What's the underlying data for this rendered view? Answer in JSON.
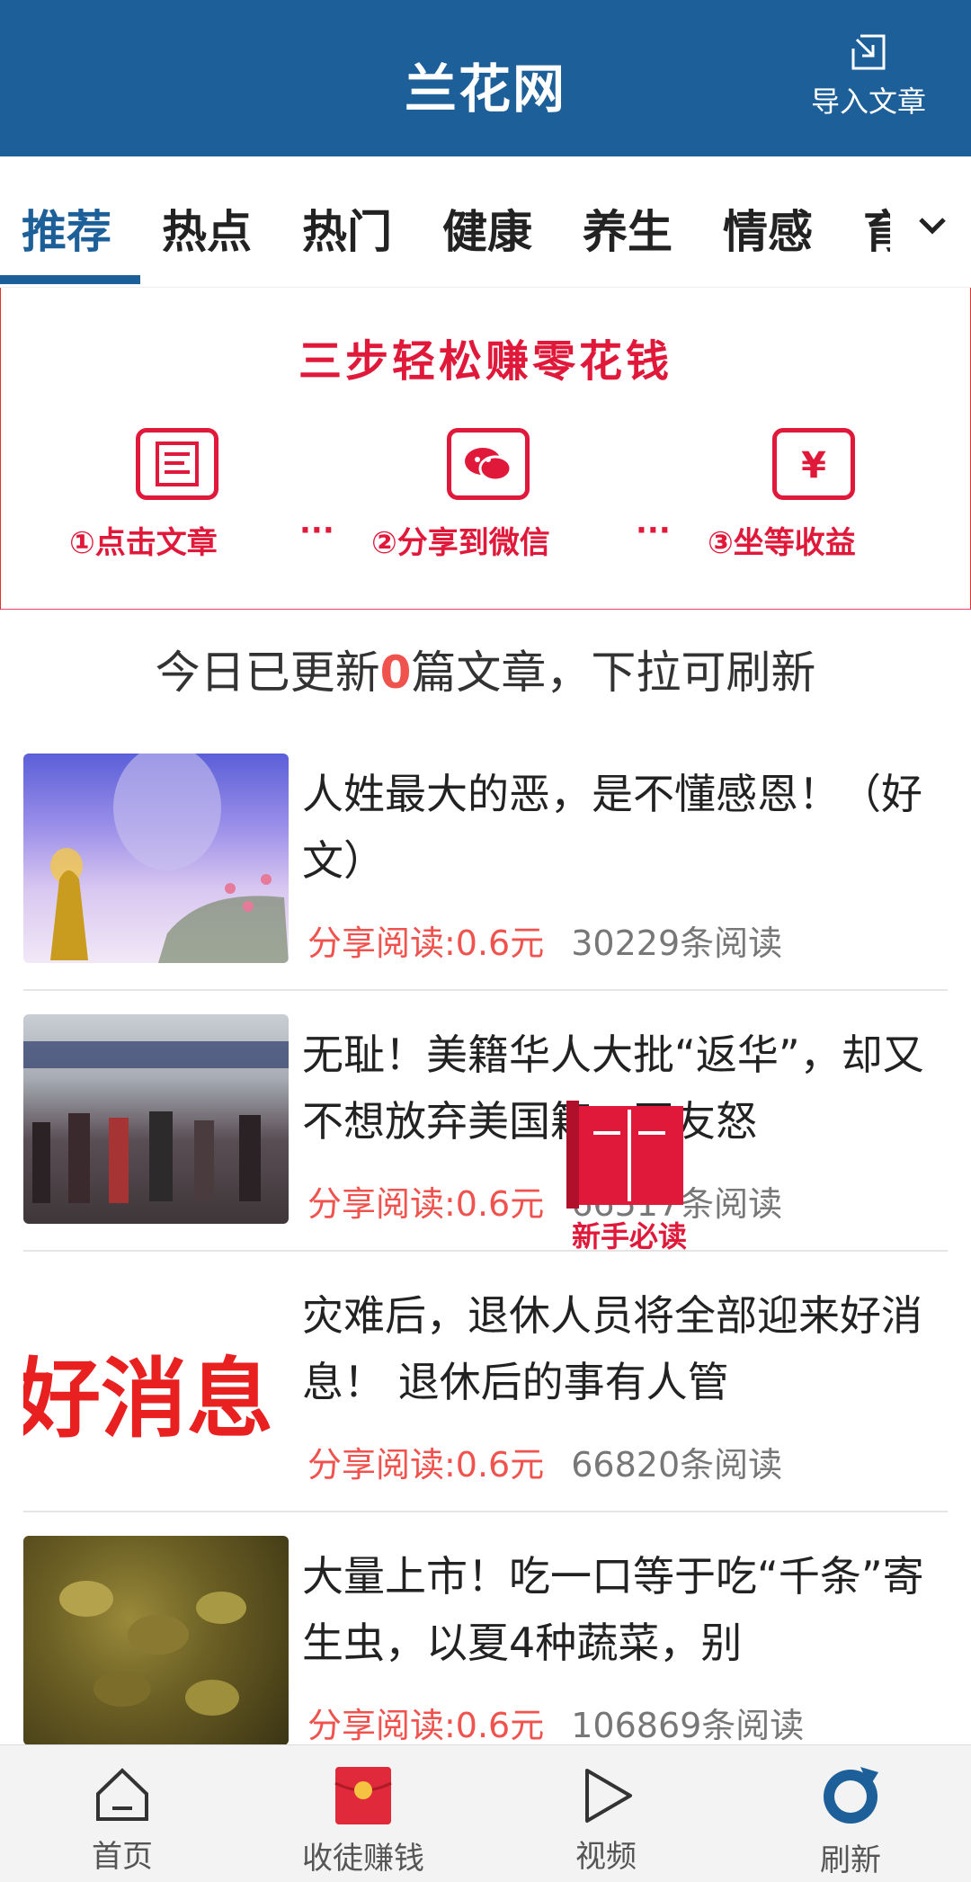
{
  "header": {
    "title": "兰花网",
    "import_label": "导入文章"
  },
  "tabs": [
    {
      "label": "推荐",
      "active": true
    },
    {
      "label": "热点"
    },
    {
      "label": "热门"
    },
    {
      "label": "健康"
    },
    {
      "label": "养生"
    },
    {
      "label": "情感"
    },
    {
      "label": "育"
    }
  ],
  "promo": {
    "title": "三步轻松赚零花钱",
    "steps": [
      {
        "label": "①点击文章",
        "icon": "article-icon"
      },
      {
        "label": "②分享到微信",
        "icon": "wechat-icon"
      },
      {
        "label": "③坐等收益",
        "icon": "yuan-icon"
      }
    ],
    "dots": "···"
  },
  "notice": {
    "prefix": "今日已更新",
    "count": "0",
    "suffix": "篇文章，下拉可刷新"
  },
  "articles": [
    {
      "title": "人姓最大的恶，是不懂感恩！（好文）",
      "share": "分享阅读:0.6元",
      "reads": "30229条阅读"
    },
    {
      "title": "无耻！美籍华人大批“返华”，却又不想放弃美国籍，网友怒",
      "share": "分享阅读:0.6元",
      "reads": "66517条阅读"
    },
    {
      "title": "灾难后，退休人员将全部迎来好消息！ 退休后的事有人管",
      "share": "分享阅读:0.6元",
      "reads": "66820条阅读",
      "thumb_text": "好消息"
    },
    {
      "title": "大量上市！吃一口等于吃“千条”寄生虫，以夏4种蔬菜，别",
      "share": "分享阅读:0.6元",
      "reads": "106869条阅读"
    }
  ],
  "guide": {
    "label": "新手必读"
  },
  "bottom_nav": [
    {
      "label": "首页",
      "icon": "home-icon"
    },
    {
      "label": "收徒赚钱",
      "icon": "red-envelope-icon"
    },
    {
      "label": "视频",
      "icon": "play-icon"
    },
    {
      "label": "刷新",
      "icon": "refresh-icon"
    }
  ],
  "colors": {
    "brand_blue": "#1d5f98",
    "promo_red": "#e0193a",
    "share_red": "#f0524d"
  }
}
